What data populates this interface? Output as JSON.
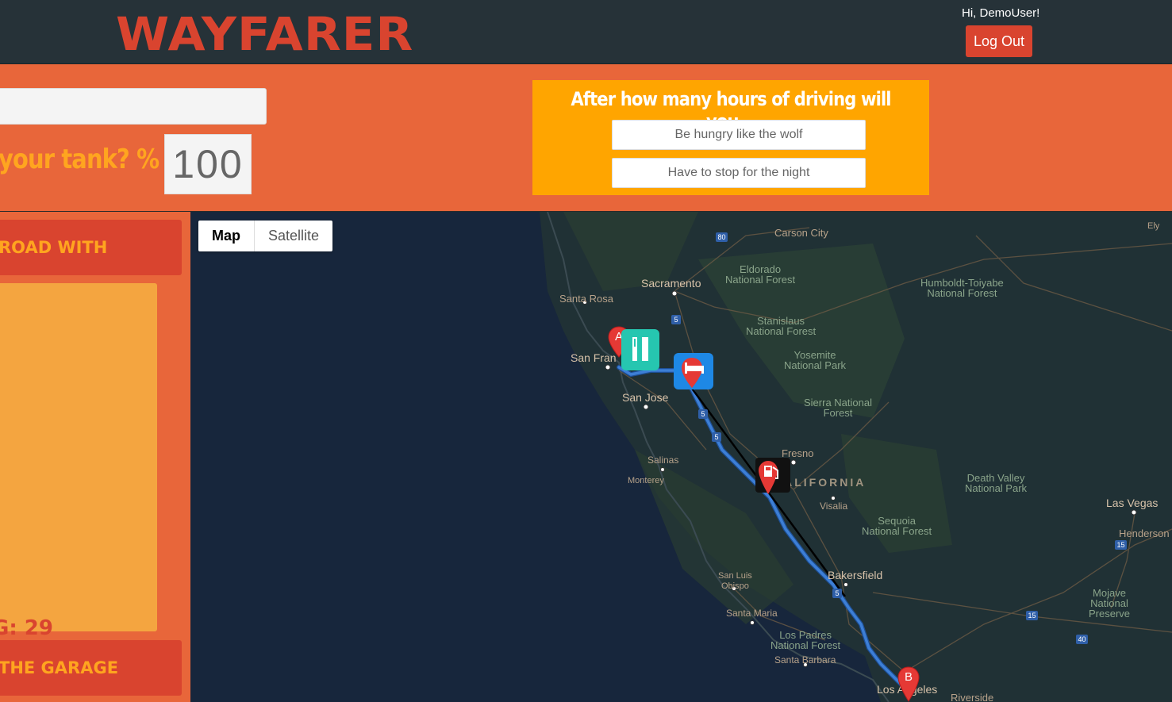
{
  "header": {
    "logo": "WAYFARER",
    "greeting": "Hi, DemoUser!",
    "logout_label": "Log Out"
  },
  "controls": {
    "start_value": "",
    "tank_label": "your tank? %",
    "tank_value": "100",
    "hours_title": "After how many hours of driving will you...",
    "hungry_placeholder": "Be hungry like the wolf",
    "night_placeholder": "Have to stop for the night"
  },
  "sidebar": {
    "top_heading": "ROAD WITH",
    "mpg_text": "G: 29",
    "bottom_heading": "THE GARAGE"
  },
  "map": {
    "type_buttons": [
      "Map",
      "Satellite"
    ],
    "active_type": "Map",
    "places": {
      "carson_city": "Carson City",
      "ely": "Ely",
      "eldorado": "Eldorado\nNational Forest",
      "sacramento": "Sacramento",
      "humboldt": "Humboldt-Toiyabe\nNational Forest",
      "santa_rosa": "Santa Rosa",
      "stanislaus": "Stanislaus\nNational Forest",
      "san_francisco": "San Fran",
      "yosemite": "Yosemite\nNational Park",
      "san_jose": "San Jose",
      "sierra": "Sierra National\nForest",
      "fresno": "Fresno",
      "salinas": "Salinas",
      "monterey": "Monterey",
      "california": "CALIFORNIA",
      "visalia": "Visalia",
      "death_valley": "Death Valley\nNational Park",
      "las_vegas": "Las Vegas",
      "henderson": "Henderson",
      "sequoia": "Sequoia\nNational Forest",
      "bakersfield": "Bakersfield",
      "san_luis_obispo": "San Luis\nObispo",
      "mojave": "Mojave\nNational\nPreserve",
      "santa_maria": "Santa Maria",
      "los_padres": "Los Padres\nNational Forest",
      "santa_barbara": "Santa Barbara",
      "los_angeles": "Los Angeles",
      "riverside": "Riverside"
    },
    "highway_shields": [
      "80",
      "5",
      "5",
      "5",
      "5",
      "15",
      "15",
      "40"
    ],
    "markers": {
      "start": "A",
      "end": "B"
    },
    "colors": {
      "route": "#3d7fd6",
      "marker_red": "#e53935",
      "restaurant_bg": "#26c6b0",
      "hotel_bg": "#1e88e5",
      "gas_bg": "#111111"
    }
  }
}
